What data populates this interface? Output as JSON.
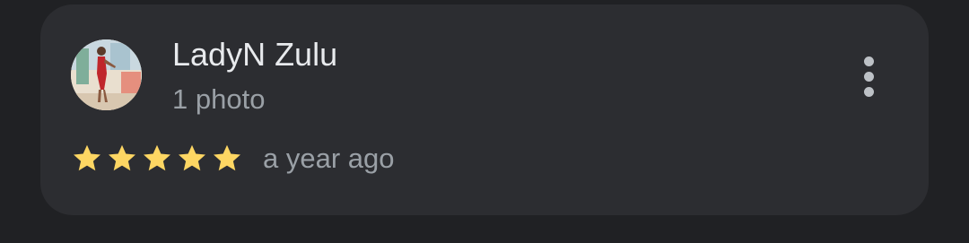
{
  "review": {
    "author_name": "LadyN Zulu",
    "author_meta": "1 photo",
    "rating": 5,
    "rating_max": 5,
    "time_ago": "a year ago",
    "star_color": "#fdd663",
    "more_icon": "more-vert-icon"
  },
  "colors": {
    "background": "#202124",
    "card": "#2c2d31",
    "primary_text": "#e8eaed",
    "secondary_text": "#9aa0a6"
  }
}
